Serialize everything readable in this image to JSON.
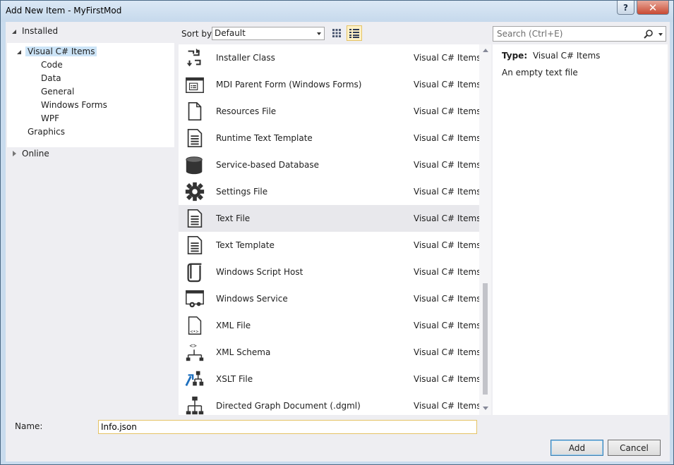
{
  "window": {
    "title": "Add New Item - MyFirstMod",
    "help_label": "?",
    "close_label": "✕"
  },
  "tree": {
    "installed_label": "Installed",
    "root_label": "Visual C# Items",
    "children": [
      "Code",
      "Data",
      "General",
      "Windows Forms",
      "WPF"
    ],
    "graphics_label": "Graphics",
    "online_label": "Online"
  },
  "toolbar": {
    "sort_label": "Sort by:",
    "sort_value": "Default",
    "search_placeholder": "Search (Ctrl+E)"
  },
  "items": [
    {
      "name": "Installer Class",
      "category": "Visual C# Items",
      "icon": "installer-class-icon"
    },
    {
      "name": "MDI Parent Form (Windows Forms)",
      "category": "Visual C# Items",
      "icon": "mdi-form-icon"
    },
    {
      "name": "Resources File",
      "category": "Visual C# Items",
      "icon": "resources-file-icon"
    },
    {
      "name": "Runtime Text Template",
      "category": "Visual C# Items",
      "icon": "text-template-icon"
    },
    {
      "name": "Service-based Database",
      "category": "Visual C# Items",
      "icon": "database-icon"
    },
    {
      "name": "Settings File",
      "category": "Visual C# Items",
      "icon": "gear-icon"
    },
    {
      "name": "Text File",
      "category": "Visual C# Items",
      "icon": "text-file-icon"
    },
    {
      "name": "Text Template",
      "category": "Visual C# Items",
      "icon": "text-template-icon"
    },
    {
      "name": "Windows Script Host",
      "category": "Visual C# Items",
      "icon": "script-icon"
    },
    {
      "name": "Windows Service",
      "category": "Visual C# Items",
      "icon": "windows-service-icon"
    },
    {
      "name": "XML File",
      "category": "Visual C# Items",
      "icon": "xml-file-icon"
    },
    {
      "name": "XML Schema",
      "category": "Visual C# Items",
      "icon": "xml-schema-icon"
    },
    {
      "name": "XSLT File",
      "category": "Visual C# Items",
      "icon": "xslt-file-icon"
    },
    {
      "name": "Directed Graph Document (.dgml)",
      "category": "Visual C# Items",
      "icon": "graph-document-icon"
    }
  ],
  "selected_item": "Text File",
  "detail": {
    "type_label": "Type:",
    "type_value": "Visual C# Items",
    "description": "An empty text file"
  },
  "bottom": {
    "name_label": "Name:",
    "name_value": "Info.json",
    "add_label": "Add",
    "cancel_label": "Cancel"
  }
}
